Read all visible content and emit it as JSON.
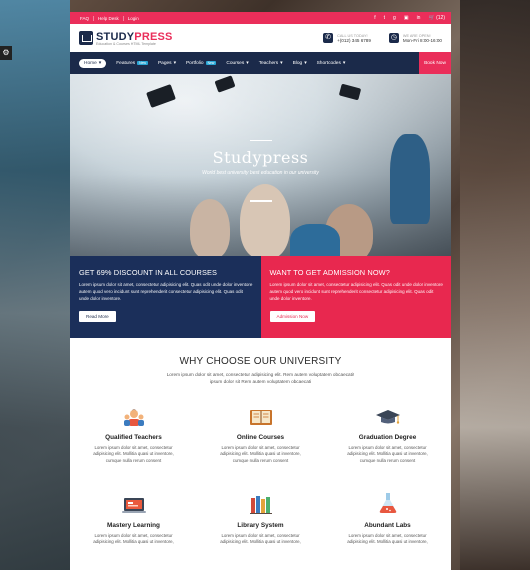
{
  "topbar": {
    "links": [
      "FAQ",
      "Help Desk",
      "Login"
    ],
    "social": [
      "f",
      "t",
      "g",
      "▣",
      "in"
    ],
    "cart": "(12)"
  },
  "header": {
    "logo_part1": "STUDY",
    "logo_part2": "PRESS",
    "logo_sub": "Education & Courses HTML Template",
    "call_label": "CALL US TODAY!",
    "call_value": "+(012) 345 6789",
    "open_label": "WE ARE OPEN!",
    "open_value": "Mon-Fri 8:00-16:00"
  },
  "nav": {
    "items": [
      {
        "label": "Home",
        "active": true,
        "badge": "",
        "caret": true
      },
      {
        "label": "Features",
        "active": false,
        "badge": "New",
        "caret": false
      },
      {
        "label": "Pages",
        "active": false,
        "badge": "",
        "caret": true
      },
      {
        "label": "Portfolio",
        "active": false,
        "badge": "New",
        "caret": false
      },
      {
        "label": "Courses",
        "active": false,
        "badge": "",
        "caret": true
      },
      {
        "label": "Teachers",
        "active": false,
        "badge": "",
        "caret": true
      },
      {
        "label": "Blog",
        "active": false,
        "badge": "",
        "caret": true
      },
      {
        "label": "Shortcodes",
        "active": false,
        "badge": "",
        "caret": true
      }
    ],
    "book_label": "Book Now"
  },
  "hero": {
    "title": "Studypress",
    "subtitle": "World best university best education in our university"
  },
  "promo": {
    "left": {
      "title": "GET 69% DISCOUNT IN ALL COURSES",
      "text": "Lorem ipsum dolor sit amet, consectetur adipisicing elit. Quas odit unde dolor inventore autem quod vero incidunt sunt reprehenderit consectetur adipisicing elit. Quas odit unde dolor inventore.",
      "button": "Read More"
    },
    "right": {
      "title": "WANT TO GET ADMISSION NOW?",
      "text": "Lorem ipsum dolor sit amet, consectetur adipisicing elit. Quas odit unde dolor inventore autem quod vero incidunt sunt reprehenderit consectetur adipisicing elit. Quas odit unde dolor inventore.",
      "button": "Admission Now"
    }
  },
  "why": {
    "title": "WHY CHOOSE OUR UNIVERSITY",
    "intro_line1": "Lorem ipsum dolor sit amet, consectetur adipisicing elit. Rem autem voluptatem obcaecati!",
    "intro_line2": "ipsum dolor sit Rem autem voluptatem obcaecati",
    "features": [
      {
        "icon": "teachers-icon",
        "title": "Qualified Teachers",
        "text": "Lorem ipsum dolor sit amet, consectetur adipisicing elit. Mollitia quasi ut inventore, cumque nulla rerum consent"
      },
      {
        "icon": "book-icon",
        "title": "Online Courses",
        "text": "Lorem ipsum dolor sit amet, consectetur adipisicing elit. Mollitia quasi ut inventore, cumque nulla rerum consent"
      },
      {
        "icon": "graduation-cap-icon",
        "title": "Graduation Degree",
        "text": "Lorem ipsum dolor sit amet, consectetur adipisicing elit. Mollitia quasi ut inventore, cumque nulla rerum consent"
      },
      {
        "icon": "laptop-icon",
        "title": "Mastery Learning",
        "text": "Lorem ipsum dolor sit amet, consectetur adipisicing elit. Mollitia quasi ut inventore,"
      },
      {
        "icon": "library-icon",
        "title": "Library System",
        "text": "Lorem ipsum dolor sit amet, consectetur adipisicing elit. Mollitia quasi ut inventore,"
      },
      {
        "icon": "flask-icon",
        "title": "Abundant Labs",
        "text": "Lorem ipsum dolor sit amet, consectetur adipisicing elit. Mollitia quasi ut inventore,"
      }
    ]
  },
  "colors": {
    "navy": "#1b2a4a",
    "accent": "#ea2e5a"
  }
}
